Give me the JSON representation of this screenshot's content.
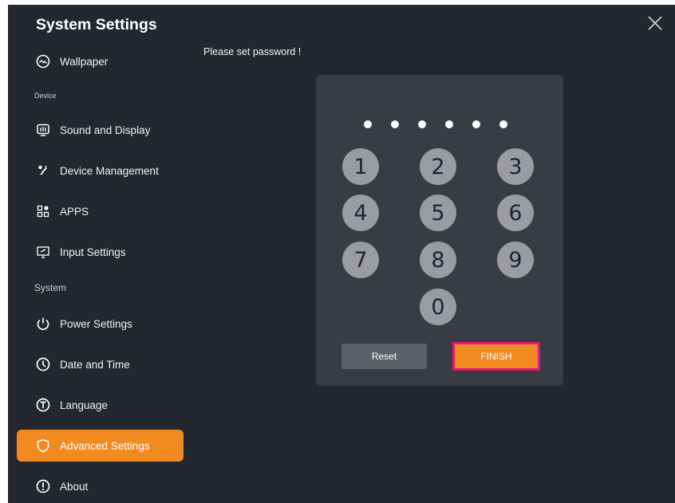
{
  "app": {
    "title": "System Settings"
  },
  "sidebar": {
    "items": [
      {
        "label": "Wallpaper",
        "icon": "wallpaper-icon"
      },
      {
        "label": "Sound and Display",
        "icon": "sound-display-icon"
      },
      {
        "label": "Device Management",
        "icon": "device-management-icon"
      },
      {
        "label": "APPS",
        "icon": "apps-icon"
      },
      {
        "label": "Input Settings",
        "icon": "input-settings-icon"
      },
      {
        "label": "Power Settings",
        "icon": "power-icon"
      },
      {
        "label": "Date and Time",
        "icon": "clock-icon"
      },
      {
        "label": "Language",
        "icon": "language-icon"
      },
      {
        "label": "Advanced Settings",
        "icon": "shield-icon",
        "active": true
      },
      {
        "label": "About",
        "icon": "info-icon"
      }
    ],
    "sections": {
      "device": "Device",
      "system": "System"
    }
  },
  "main": {
    "prompt": "Please set password !",
    "password_dots": 6,
    "keypad": [
      "1",
      "2",
      "3",
      "4",
      "5",
      "6",
      "7",
      "8",
      "9",
      "0"
    ],
    "reset_label": "Reset",
    "finish_label": "FINISH"
  },
  "colors": {
    "background": "#24272e",
    "panel": "#393c43",
    "accent": "#f28a22",
    "highlight_border": "#e5157a",
    "key": "#9a9ca2"
  }
}
